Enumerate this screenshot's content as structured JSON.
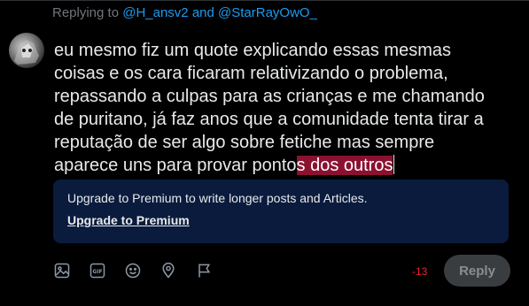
{
  "reply_context": {
    "prefix": "Replying to ",
    "handles": "@H_ansv2 and @StarRayOwO_"
  },
  "composer": {
    "text_normal": "eu mesmo fiz um quote explicando essas mesmas coisas e os cara ficaram relativizando o problema, repassando a culpas para as crianças e me chamando de puritano, já faz anos que a comunidade tenta tirar a reputação de ser algo sobre fetiche mas sempre aparece uns para provar ponto",
    "text_overflow": "s dos outros"
  },
  "premium_upsell": {
    "message": "Upgrade to Premium to write longer posts and Articles.",
    "link_label": "Upgrade to Premium"
  },
  "toolbar": {
    "icons": [
      "image-icon",
      "gif-icon",
      "emoji-icon",
      "location-icon",
      "schedule-icon"
    ]
  },
  "char_counter": "-13",
  "reply_button_label": "Reply",
  "colors": {
    "background": "#000000",
    "accent": "#1d9bf0",
    "overflow_highlight": "#8b1131",
    "counter_over": "#f4212e",
    "premium_box": "#0a1b3d",
    "reply_disabled_bg": "#3a3d40"
  }
}
